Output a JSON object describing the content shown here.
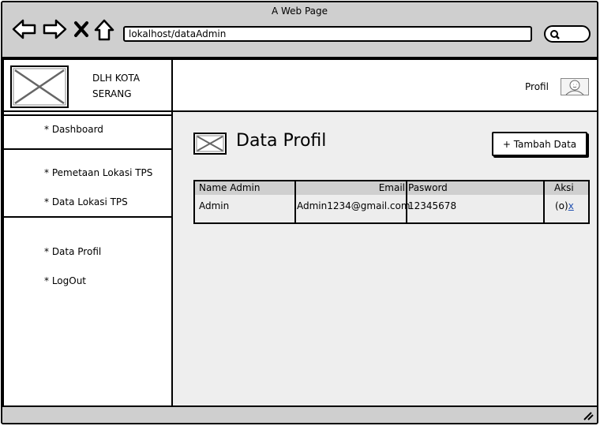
{
  "window": {
    "title": "A Web Page"
  },
  "browser": {
    "url": "lokalhost/dataAdmin",
    "icons": [
      "back-arrow-icon",
      "forward-arrow-icon",
      "close-icon",
      "home-icon",
      "search-icon"
    ]
  },
  "brand": {
    "line1": "DLH KOTA",
    "line2": "SERANG",
    "logo": "image-placeholder"
  },
  "header": {
    "profile_label": "Profil",
    "avatar": "user-avatar-icon"
  },
  "sidebar": {
    "items": [
      {
        "label": "* Dashboard"
      },
      {
        "label": "* Pemetaan Lokasi TPS"
      },
      {
        "label": "* Data Lokasi TPS"
      },
      {
        "label": "* Data Profil"
      },
      {
        "label": "* LogOut"
      }
    ]
  },
  "main": {
    "title": "Data Profil",
    "add_button": "+ Tambah Data",
    "table": {
      "columns": [
        "Name Admin",
        "Email",
        "Pasword",
        "Aksi"
      ],
      "rows": [
        {
          "name": "Admin",
          "email": "Admin1234@gmail.com",
          "password": "12345678",
          "action_view": "(o)",
          "action_delete": "x"
        }
      ]
    }
  },
  "colors": {
    "chrome": "#cfcfcf",
    "content_bg": "#eeeeee",
    "link": "#1f4fb0"
  }
}
